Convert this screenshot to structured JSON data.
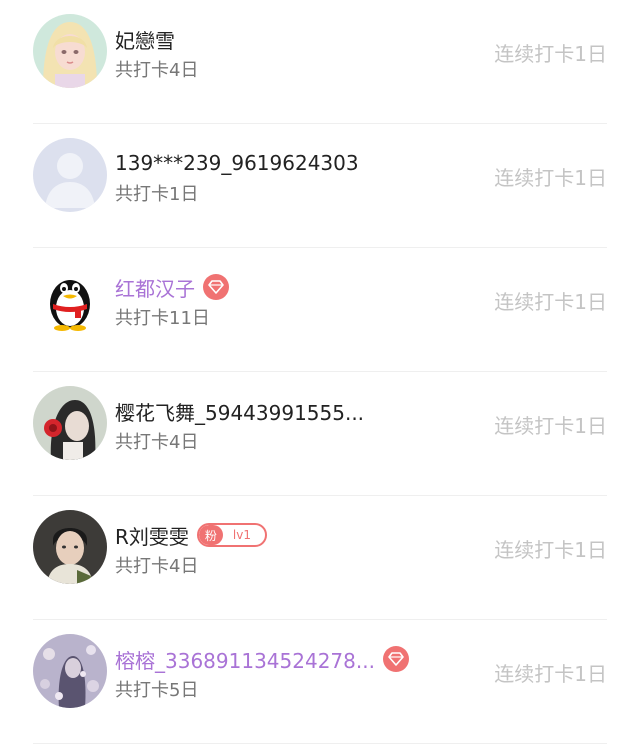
{
  "users": [
    {
      "name": "妃戀雪",
      "total": "共打卡4日",
      "streak": "连续打卡1日",
      "vip": false,
      "badge": null
    },
    {
      "name": "139***239_9619624303",
      "total": "共打卡1日",
      "streak": "连续打卡1日",
      "vip": false,
      "badge": null
    },
    {
      "name": "红都汉子",
      "total": "共打卡11日",
      "streak": "连续打卡1日",
      "vip": true,
      "badge": "diamond"
    },
    {
      "name": "樱花飞舞_59443991555...",
      "total": "共打卡4日",
      "streak": "连续打卡1日",
      "vip": false,
      "badge": null
    },
    {
      "name": "R刘雯雯",
      "total": "共打卡4日",
      "streak": "连续打卡1日",
      "vip": false,
      "badge": "fan"
    },
    {
      "name": "榕榕_336891134524278...",
      "total": "共打卡5日",
      "streak": "连续打卡1日",
      "vip": true,
      "badge": "diamond"
    }
  ],
  "fan_badge": {
    "tag": "粉",
    "level": "lv1"
  },
  "colors": {
    "vip_name": "#a973d6",
    "badge": "#f07272",
    "streak": "#c4c4c4",
    "total": "#777777"
  },
  "avatars": [
    "anime-girl-avatar",
    "default-person-avatar",
    "qq-penguin-avatar",
    "girl-headphones-avatar",
    "young-man-avatar",
    "flower-girl-avatar"
  ]
}
